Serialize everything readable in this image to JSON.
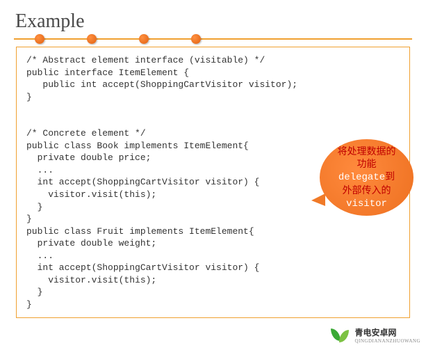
{
  "title": "Example",
  "code": "/* Abstract element interface (visitable) */\npublic interface ItemElement {\n   public int accept(ShoppingCartVisitor visitor);\n}\n\n\n/* Concrete element */\npublic class Book implements ItemElement{\n  private double price;\n  ...\n  int accept(ShoppingCartVisitor visitor) {\n    visitor.visit(this);\n  }\n}\npublic class Fruit implements ItemElement{\n  private double weight;\n  ...\n  int accept(ShoppingCartVisitor visitor) {\n    visitor.visit(this);\n  }\n}",
  "callout": {
    "line1": "将处理数据的",
    "line2": "功能",
    "line3a": "delegate",
    "line3b": "到",
    "line4": "外部传入的",
    "line5": "visitor"
  },
  "watermark": {
    "name": "青电安卓网",
    "sub": "QINGDIANANZHUOWANG"
  }
}
